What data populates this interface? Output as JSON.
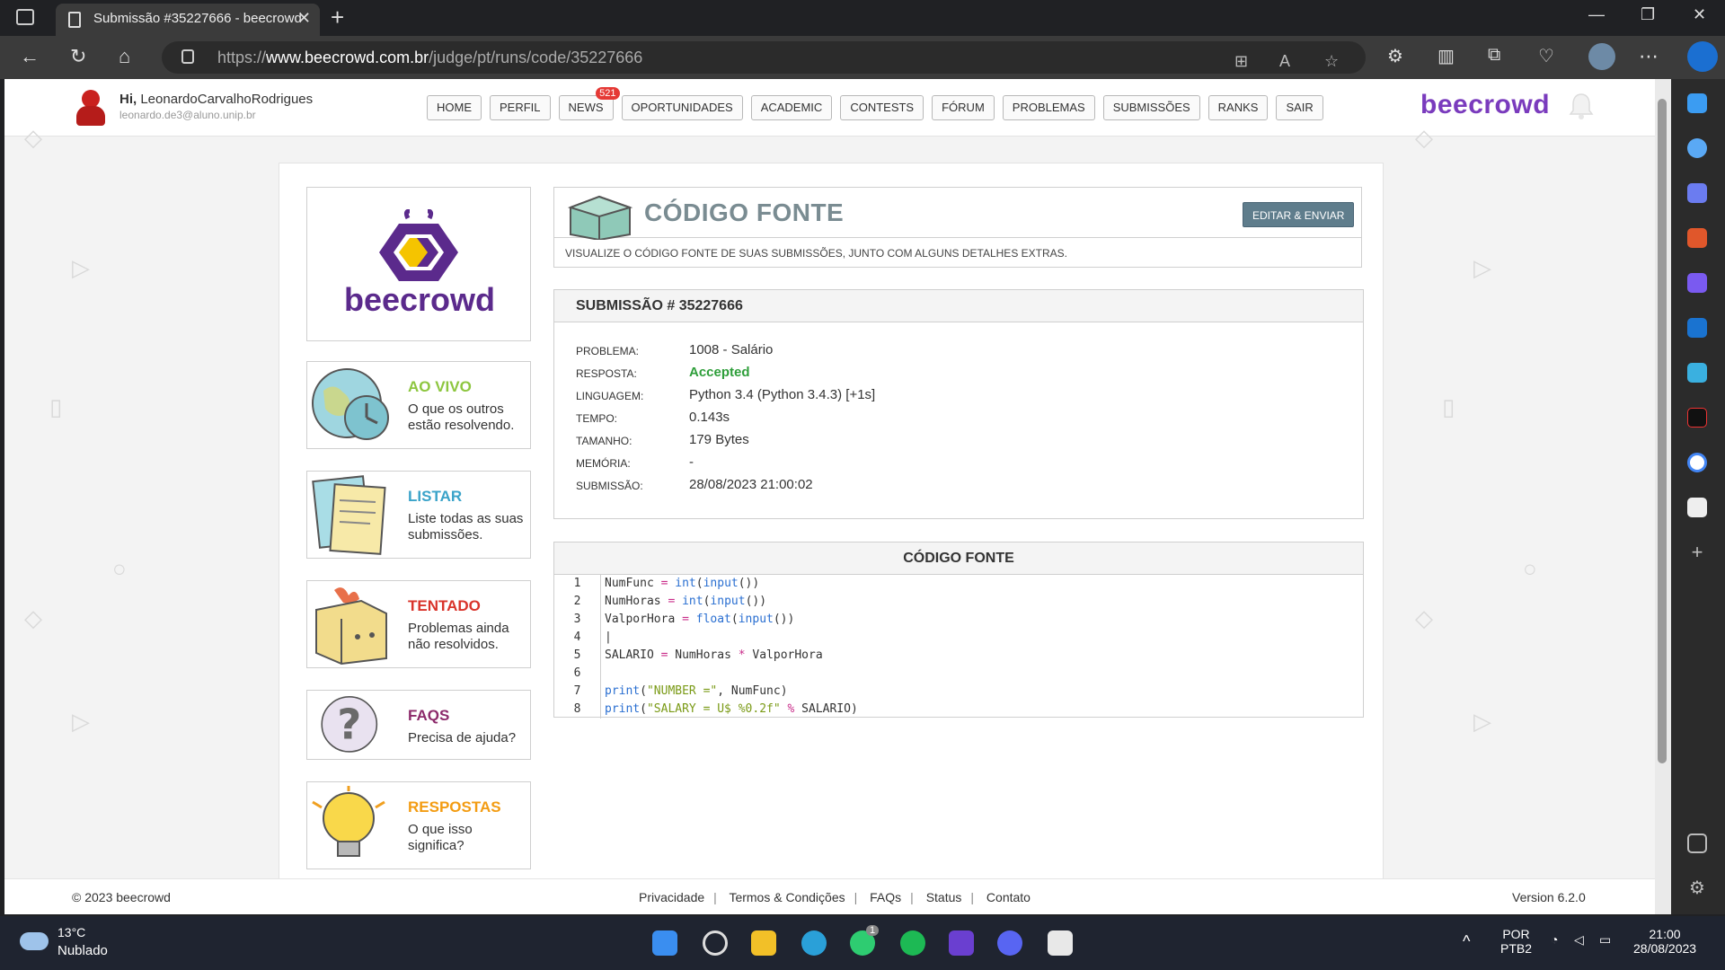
{
  "browser": {
    "tab_title": "Submissão #35227666 - beecrowd",
    "url_prefix": "https://",
    "url_domain": "www.beecrowd.com.br",
    "url_path": "/judge/pt/runs/code/35227666"
  },
  "header": {
    "hi": "Hi,",
    "username": "LeonardoCarvalhoRodrigues",
    "email": "leonardo.de3@aluno.unip.br",
    "brand": "beecrowd",
    "nav": [
      {
        "label": "HOME"
      },
      {
        "label": "PERFIL"
      },
      {
        "label": "NEWS",
        "badge": "521"
      },
      {
        "label": "OPORTUNIDADES"
      },
      {
        "label": "ACADEMIC"
      },
      {
        "label": "CONTESTS"
      },
      {
        "label": "FÓRUM"
      },
      {
        "label": "PROBLEMAS"
      },
      {
        "label": "SUBMISSÕES"
      },
      {
        "label": "RANKS"
      },
      {
        "label": "SAIR"
      }
    ]
  },
  "sidebar": {
    "logo_text": "beecrowd",
    "cards": [
      {
        "title": "AO VIVO",
        "desc": "O que os outros estão resolvendo.",
        "color": "#8dc63f"
      },
      {
        "title": "LISTAR",
        "desc": "Liste todas as suas submissões.",
        "color": "#3aa3c9"
      },
      {
        "title": "TENTADO",
        "desc": "Problemas ainda não resolvidos.",
        "color": "#d9342b"
      },
      {
        "title": "FAQS",
        "desc": "Precisa de ajuda?",
        "color": "#8c2a6b"
      },
      {
        "title": "RESPOSTAS",
        "desc": "O que isso significa?",
        "color": "#f39c12"
      }
    ]
  },
  "page": {
    "title": "CÓDIGO FONTE",
    "edit_button": "EDITAR & ENVIAR",
    "subtitle": "VISUALIZE O CÓDIGO FONTE DE SUAS SUBMISSÕES, JUNTO COM ALGUNS DETALHES EXTRAS."
  },
  "submission": {
    "heading": "SUBMISSÃO # 35227666",
    "rows": [
      {
        "label": "PROBLEMA:",
        "value": "1008 - Salário"
      },
      {
        "label": "RESPOSTA:",
        "value": "Accepted"
      },
      {
        "label": "LINGUAGEM:",
        "value": "Python 3.4 (Python 3.4.3) [+1s]"
      },
      {
        "label": "TEMPO:",
        "value": "0.143s"
      },
      {
        "label": "TAMANHO:",
        "value": "179 Bytes"
      },
      {
        "label": "MEMÓRIA:",
        "value": "-"
      },
      {
        "label": "SUBMISSÃO:",
        "value": "28/08/2023 21:00:02"
      }
    ]
  },
  "code": {
    "heading": "CÓDIGO FONTE",
    "lines": [
      {
        "n": "1",
        "text": "NumFunc = int(input())"
      },
      {
        "n": "2",
        "text": "NumHoras = int(input())"
      },
      {
        "n": "3",
        "text": "ValporHora = float(input())"
      },
      {
        "n": "4",
        "text": ""
      },
      {
        "n": "5",
        "text": "SALARIO = NumHoras * ValporHora"
      },
      {
        "n": "6",
        "text": ""
      },
      {
        "n": "7",
        "text": "print(\"NUMBER =\", NumFunc)"
      },
      {
        "n": "8",
        "text": "print(\"SALARY = U$ %0.2f\" % SALARIO)"
      }
    ]
  },
  "footer": {
    "copyright": "© 2023 beecrowd",
    "links": [
      "Privacidade",
      "Termos & Condições",
      "FAQs",
      "Status",
      "Contato"
    ],
    "version": "Version 6.2.0"
  },
  "taskbar": {
    "temperature": "13°C",
    "condition": "Nublado",
    "whatsapp_badge": "1",
    "lang1": "POR",
    "lang2": "PTB2",
    "time": "21:00",
    "date": "28/08/2023"
  }
}
